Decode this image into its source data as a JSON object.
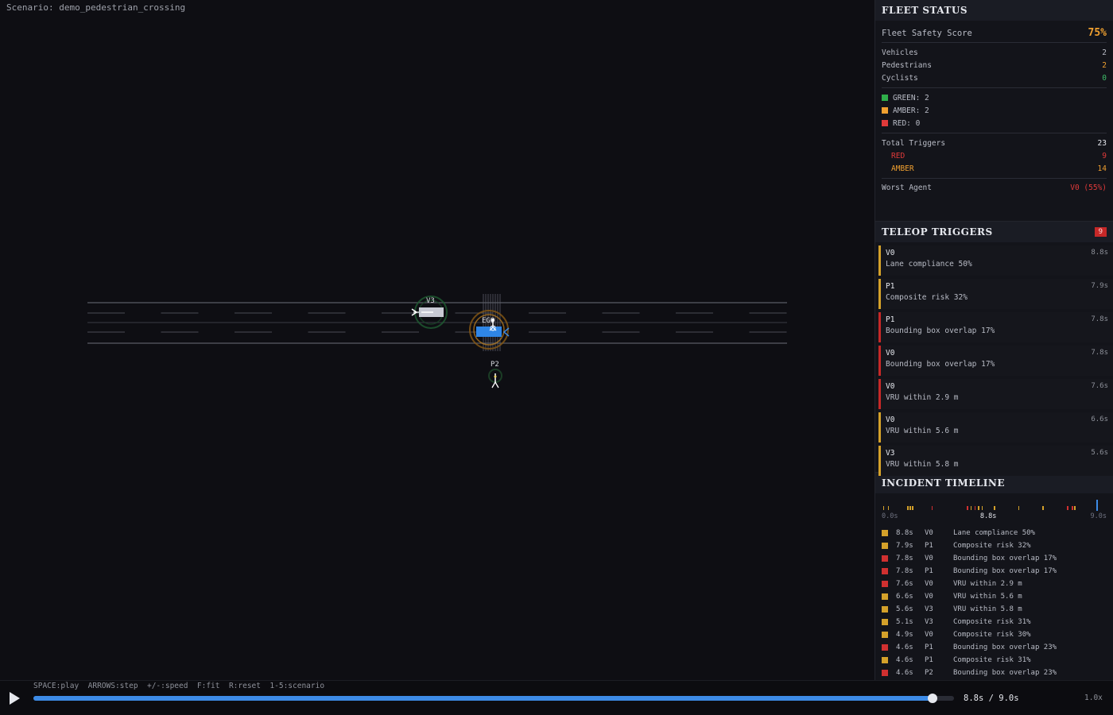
{
  "scenario_label": "Scenario: demo_pedestrian_crossing",
  "scene": {
    "agents": [
      {
        "id": "V3",
        "kind": "vehicle",
        "status": "green"
      },
      {
        "id": "EGO",
        "kind": "vehicle",
        "status": "amber"
      },
      {
        "id": "P2",
        "kind": "pedestrian",
        "status": "green"
      }
    ]
  },
  "fleet": {
    "title": "FLEET STATUS",
    "score_label": "Fleet Safety Score",
    "score_value": "75%",
    "counts": [
      {
        "label": "Vehicles",
        "value": "2",
        "color": "#b9bcc6"
      },
      {
        "label": "Pedestrians",
        "value": "2",
        "color": "#f0a030"
      },
      {
        "label": "Cyclists",
        "value": "0",
        "color": "#3fbf6a"
      }
    ],
    "legend": [
      {
        "label": "GREEN: 2",
        "color": "#2faf4a"
      },
      {
        "label": "AMBER: 2",
        "color": "#f0a030"
      },
      {
        "label": "RED: 0",
        "color": "#e03a3a"
      }
    ],
    "total_triggers_label": "Total Triggers",
    "total_triggers_value": "23",
    "red_label": "RED",
    "red_value": "9",
    "amber_label": "AMBER",
    "amber_value": "14",
    "worst_label": "Worst Agent",
    "worst_value": "V0 (55%)"
  },
  "teleop": {
    "title": "TELEOP TRIGGERS",
    "badge": "9",
    "items": [
      {
        "agent": "V0",
        "time": "8.8s",
        "msg": "Lane compliance 50%",
        "level": "amber"
      },
      {
        "agent": "P1",
        "time": "7.9s",
        "msg": "Composite risk 32%",
        "level": "amber"
      },
      {
        "agent": "P1",
        "time": "7.8s",
        "msg": "Bounding box overlap 17%",
        "level": "red"
      },
      {
        "agent": "V0",
        "time": "7.8s",
        "msg": "Bounding box overlap 17%",
        "level": "red"
      },
      {
        "agent": "V0",
        "time": "7.6s",
        "msg": "VRU within 2.9 m",
        "level": "red"
      },
      {
        "agent": "V0",
        "time": "6.6s",
        "msg": "VRU within 5.6 m",
        "level": "amber"
      },
      {
        "agent": "V3",
        "time": "5.6s",
        "msg": "VRU within 5.8 m",
        "level": "amber"
      }
    ]
  },
  "timeline": {
    "title": "INCIDENT TIMELINE",
    "start_label": "0.0s",
    "current_label": "8.8s",
    "end_label": "9.0s",
    "current_time": 8.8,
    "duration": 9.0,
    "ticks": [
      {
        "t": 0.05,
        "level": "amber"
      },
      {
        "t": 0.25,
        "level": "amber"
      },
      {
        "t": 1.05,
        "level": "amber"
      },
      {
        "t": 1.15,
        "level": "amber"
      },
      {
        "t": 1.25,
        "level": "amber"
      },
      {
        "t": 2.05,
        "level": "red"
      },
      {
        "t": 3.5,
        "level": "red"
      },
      {
        "t": 3.65,
        "level": "amber"
      },
      {
        "t": 3.8,
        "level": "red"
      },
      {
        "t": 3.95,
        "level": "amber"
      },
      {
        "t": 4.1,
        "level": "amber"
      },
      {
        "t": 4.6,
        "level": "amber"
      },
      {
        "t": 5.6,
        "level": "amber"
      },
      {
        "t": 6.6,
        "level": "amber"
      },
      {
        "t": 7.6,
        "level": "red"
      },
      {
        "t": 7.8,
        "level": "red"
      },
      {
        "t": 7.9,
        "level": "amber"
      }
    ],
    "incidents": [
      {
        "time": "8.8s",
        "agent": "V0",
        "msg": "Lane compliance 50%",
        "level": "amber"
      },
      {
        "time": "7.9s",
        "agent": "P1",
        "msg": "Composite risk 32%",
        "level": "amber"
      },
      {
        "time": "7.8s",
        "agent": "V0",
        "msg": "Bounding box overlap 17%",
        "level": "red"
      },
      {
        "time": "7.8s",
        "agent": "P1",
        "msg": "Bounding box overlap 17%",
        "level": "red"
      },
      {
        "time": "7.6s",
        "agent": "V0",
        "msg": "VRU within 2.9 m",
        "level": "red"
      },
      {
        "time": "6.6s",
        "agent": "V0",
        "msg": "VRU within 5.6 m",
        "level": "amber"
      },
      {
        "time": "5.6s",
        "agent": "V3",
        "msg": "VRU within 5.8 m",
        "level": "amber"
      },
      {
        "time": "5.1s",
        "agent": "V3",
        "msg": "Composite risk 31%",
        "level": "amber"
      },
      {
        "time": "4.9s",
        "agent": "V0",
        "msg": "Composite risk 30%",
        "level": "amber"
      },
      {
        "time": "4.6s",
        "agent": "P1",
        "msg": "Bounding box overlap 23%",
        "level": "red"
      },
      {
        "time": "4.6s",
        "agent": "P1",
        "msg": "Composite risk 31%",
        "level": "amber"
      },
      {
        "time": "4.6s",
        "agent": "P2",
        "msg": "Bounding box overlap 23%",
        "level": "red"
      }
    ]
  },
  "playback": {
    "hints": "SPACE:play  ARROWS:step  +/-:speed  F:fit  R:reset  1-5:scenario",
    "progress": 0.977,
    "time_readout": "8.8s / 9.0s",
    "speed": "1.0x"
  },
  "colors": {
    "amber": "#d4a12a",
    "red": "#d03030",
    "green": "#2faf4a",
    "accent": "#3d8be6"
  }
}
